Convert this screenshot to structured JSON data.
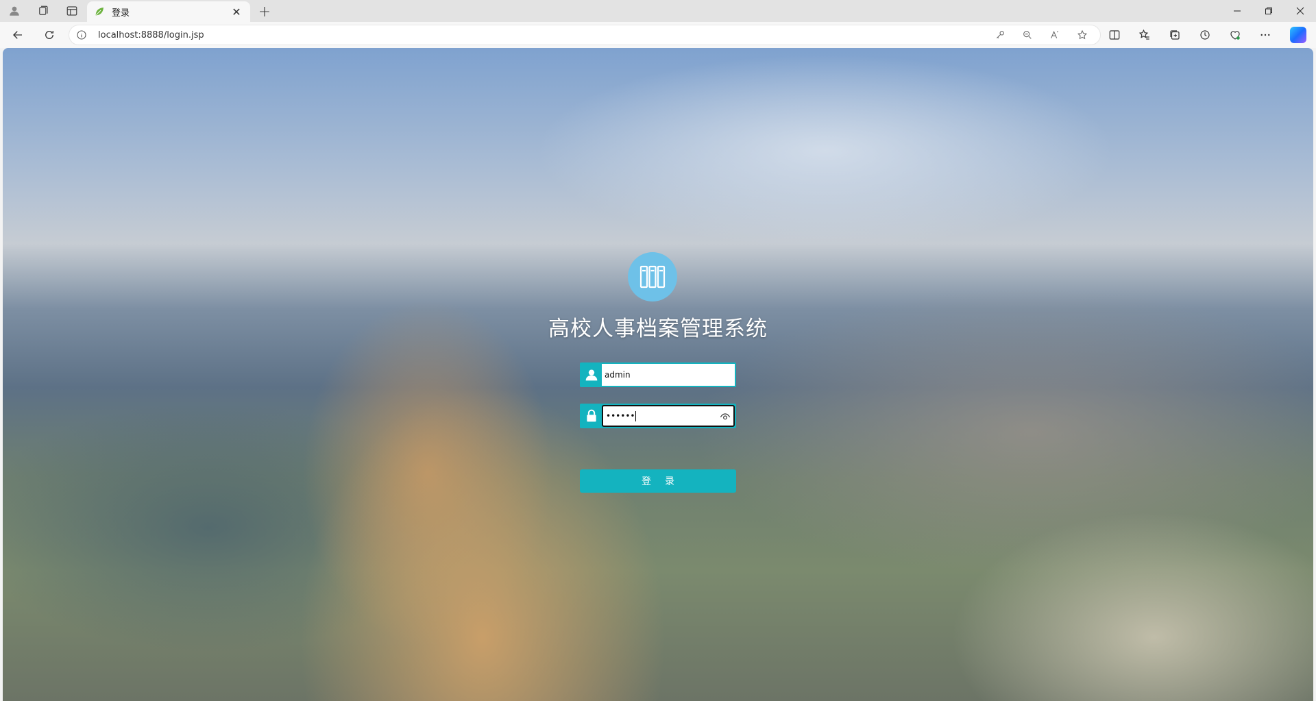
{
  "browser": {
    "tab": {
      "title": "登录"
    },
    "address": {
      "url": "localhost:8888/login.jsp"
    }
  },
  "page": {
    "system_title": "高校人事档案管理系统",
    "username_value": "admin",
    "password_value": "••••••",
    "login_label": "登录"
  },
  "colors": {
    "accent": "#14b3bf",
    "logo": "#6ec1e8"
  }
}
